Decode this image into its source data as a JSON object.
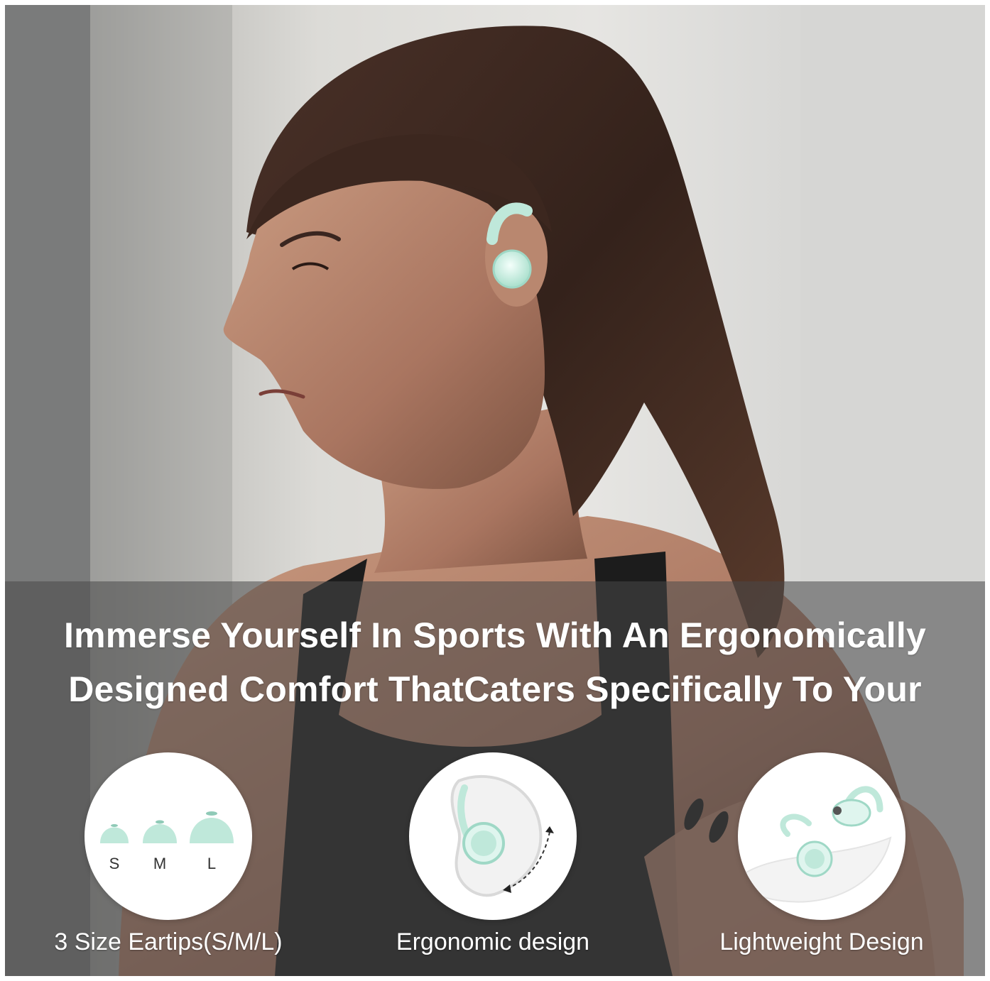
{
  "headline": {
    "line1": "Immerse Yourself In Sports With An Ergonomically",
    "line2": "Designed Comfort ThatCaters Specifically To Your"
  },
  "features": [
    {
      "label": "3 Size Eartips(S/M/L)",
      "icon": "eartips-icon",
      "sizes": [
        "S",
        "M",
        "L"
      ]
    },
    {
      "label": "Ergonomic design",
      "icon": "ear-fit-icon"
    },
    {
      "label": "Lightweight Design",
      "icon": "feather-earbuds-icon"
    }
  ],
  "colors": {
    "product_accent": "#bfe8da",
    "product_light": "#dff5ee",
    "band_overlay": "rgba(72,72,72,0.55)",
    "text": "#ffffff"
  }
}
